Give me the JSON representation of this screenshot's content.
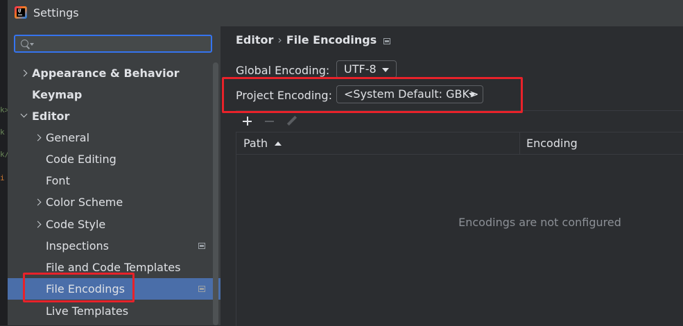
{
  "window": {
    "title": "Settings"
  },
  "search": {
    "placeholder": ""
  },
  "tree": {
    "appearance": "Appearance & Behavior",
    "keymap": "Keymap",
    "editor": "Editor",
    "general": "General",
    "code_editing": "Code Editing",
    "font": "Font",
    "color_scheme": "Color Scheme",
    "code_style": "Code Style",
    "inspections": "Inspections",
    "file_code_templates": "File and Code Templates",
    "file_encodings": "File Encodings",
    "live_templates": "Live Templates"
  },
  "breadcrumb": {
    "parent": "Editor",
    "separator": "›",
    "current": "File Encodings"
  },
  "global_encoding": {
    "label": "Global Encoding:",
    "value": "UTF-8"
  },
  "project_encoding": {
    "label": "Project Encoding:",
    "value": "<System Default: GBK>"
  },
  "table": {
    "col_path": "Path",
    "col_encoding": "Encoding",
    "empty_text": "Encodings are not configured"
  },
  "colors": {
    "accent": "#3574f0",
    "selected": "#4a6ea9",
    "highlight": "#e8222a"
  }
}
